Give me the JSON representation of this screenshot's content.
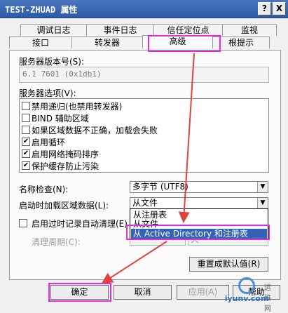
{
  "window": {
    "title": "TEST-ZHUAD 属性",
    "help_btn": "?",
    "close_btn": "X"
  },
  "tabs_back": [
    "调试日志",
    "事件日志",
    "信任定位点",
    "监视"
  ],
  "tabs_front": [
    "接口",
    "转发器",
    "高级",
    "根提示"
  ],
  "active_tab": "高级",
  "server_version": {
    "label": "服务器版本号(S):",
    "value": "6.1 7601 (0x1db1)"
  },
  "server_options": {
    "label": "服务器选项(V):",
    "items": [
      {
        "label": "禁用递归(也禁用转发器)",
        "checked": false
      },
      {
        "label": "BIND 辅助区域",
        "checked": false
      },
      {
        "label": "如果区域数据不正确，加载会失败",
        "checked": false
      },
      {
        "label": "启用循环",
        "checked": true
      },
      {
        "label": "启用网络掩码排序",
        "checked": true
      },
      {
        "label": "保护缓存防止污染",
        "checked": true
      }
    ]
  },
  "name_check": {
    "label": "名称检查(N):",
    "value": "多字节 (UTF8)"
  },
  "load_zone": {
    "label": "启动时加载区域数据(L):",
    "value": "从文件"
  },
  "dropdown_options": [
    {
      "label": "从注册表",
      "selected": false
    },
    {
      "label": "从文件",
      "selected": false
    },
    {
      "label": "从 Active Directory 和注册表",
      "selected": true
    }
  ],
  "scavenging": {
    "label": "启用过时记录自动清理(E)",
    "checked": false,
    "period_label": "清理周期(C):",
    "unit_value": "天"
  },
  "buttons": {
    "reset": "重置成默认值(R)",
    "ok": "确定",
    "cancel": "取消",
    "apply": "应用(A)",
    "help": "帮助"
  },
  "watermark": {
    "text": "iyunv.com",
    "sub": "运维网"
  },
  "colors": {
    "highlight": "#e42ce4",
    "arrow": "#e0433e",
    "selection": "#3263b5"
  }
}
